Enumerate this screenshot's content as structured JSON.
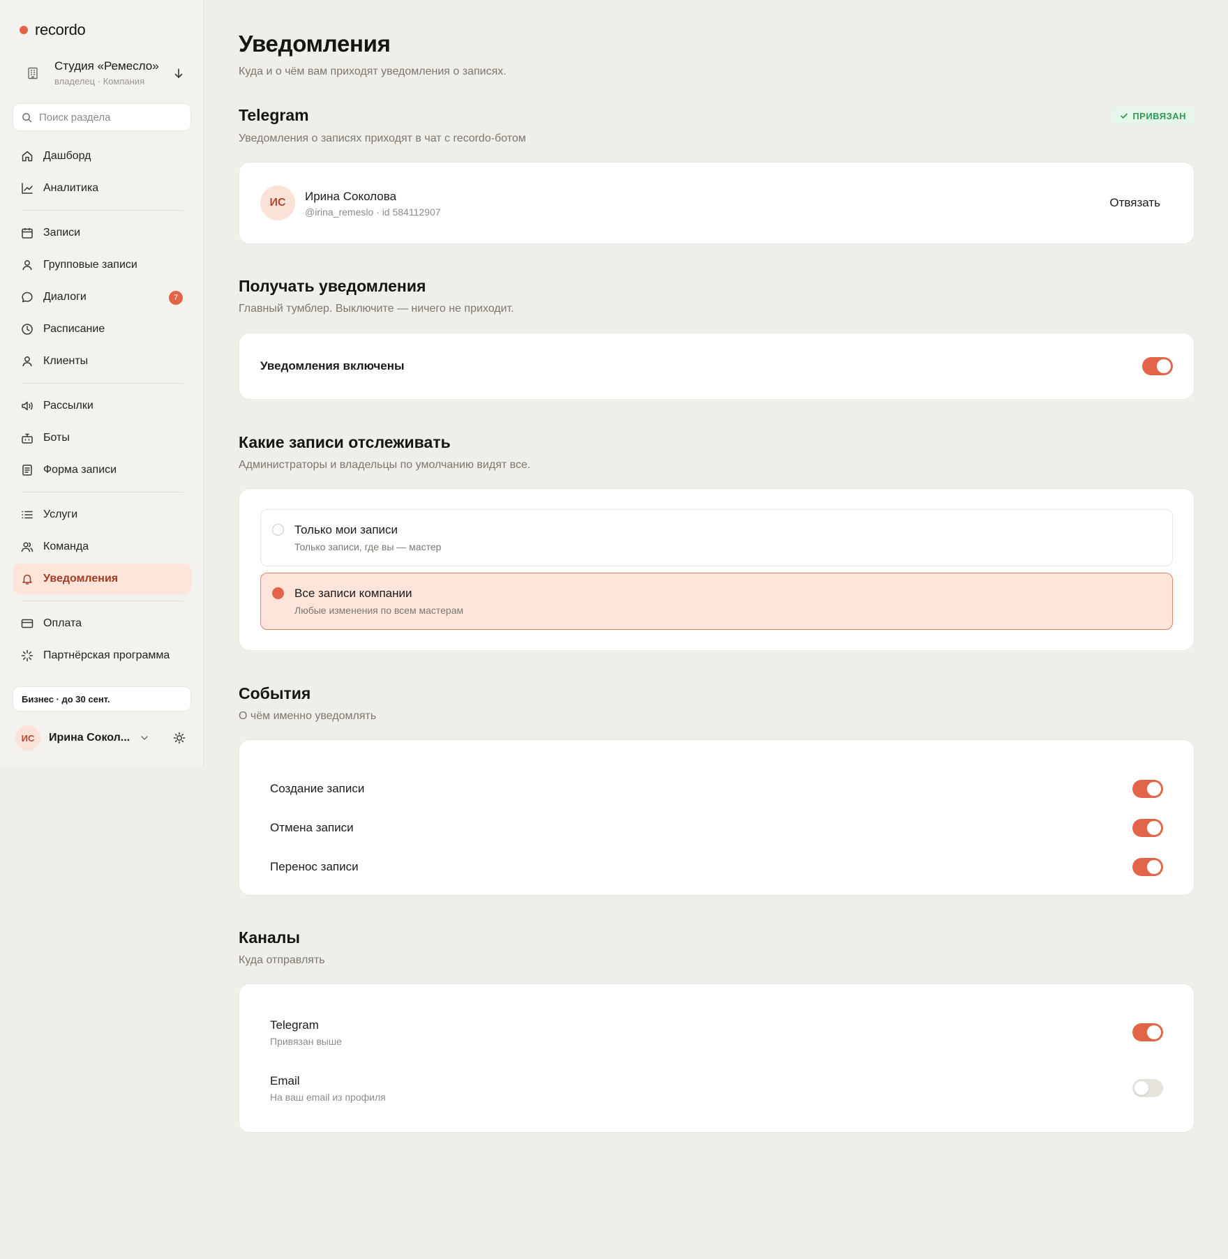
{
  "app": {
    "logo": "recordo",
    "accent": "#e2654a"
  },
  "company": {
    "name": "Студия «Ремесло»",
    "role": "владелец · Компания"
  },
  "search": {
    "placeholder": "Поиск раздела"
  },
  "nav": {
    "group1": [
      {
        "label": "Дашборд",
        "icon": "home-icon"
      },
      {
        "label": "Аналитика",
        "icon": "chart-line-icon"
      }
    ],
    "group2": [
      {
        "label": "Записи",
        "icon": "calendar-icon"
      },
      {
        "label": "Групповые записи",
        "icon": "user-icon"
      },
      {
        "label": "Диалоги",
        "icon": "chat-icon",
        "badge": "7"
      },
      {
        "label": "Расписание",
        "icon": "clock-icon"
      },
      {
        "label": "Клиенты",
        "icon": "user-icon"
      }
    ],
    "group3": [
      {
        "label": "Рассылки",
        "icon": "megaphone-icon"
      },
      {
        "label": "Боты",
        "icon": "bot-icon"
      },
      {
        "label": "Форма записи",
        "icon": "form-icon"
      }
    ],
    "group4": [
      {
        "label": "Услуги",
        "icon": "list-icon"
      },
      {
        "label": "Команда",
        "icon": "users-icon"
      },
      {
        "label": "Уведомления",
        "icon": "bell-icon",
        "active": true
      }
    ],
    "group5": [
      {
        "label": "Оплата",
        "icon": "card-icon"
      },
      {
        "label": "Партнёрская программа",
        "icon": "sparkle-icon"
      }
    ]
  },
  "plan": {
    "label": "Бизнес · до 30 сент."
  },
  "user": {
    "initials": "ИС",
    "name": "Ирина Сокол..."
  },
  "page": {
    "title": "Уведомления",
    "subtitle": "Куда и о чём вам приходят уведомления о записях."
  },
  "telegram": {
    "title": "Telegram",
    "subtitle": "Уведомления о записях приходят в чат с recordo-ботом",
    "status": "ПРИВЯЗАН",
    "account": {
      "initials": "ИС",
      "name": "Ирина Соколова",
      "handle": "@irina_remeslo · id 584112907"
    },
    "unlink_label": "Отвязать"
  },
  "receive": {
    "title": "Получать уведомления",
    "subtitle": "Главный тумблер. Выключите — ничего не приходит.",
    "label": "Уведомления включены",
    "enabled": true
  },
  "scope": {
    "title": "Какие записи отслеживать",
    "subtitle": "Администраторы и владельцы по умолчанию видят все.",
    "options": [
      {
        "title": "Только мои записи",
        "subtitle": "Только записи, где вы — мастер",
        "selected": false
      },
      {
        "title": "Все записи компании",
        "subtitle": "Любые изменения по всем мастерам",
        "selected": true
      }
    ]
  },
  "events": {
    "title": "События",
    "subtitle": "О чём именно уведомлять",
    "items": [
      {
        "label": "Создание записи",
        "enabled": true
      },
      {
        "label": "Отмена записи",
        "enabled": true
      },
      {
        "label": "Перенос записи",
        "enabled": true
      }
    ]
  },
  "channels": {
    "title": "Каналы",
    "subtitle": "Куда отправлять",
    "items": [
      {
        "title": "Telegram",
        "subtitle": "Привязан выше",
        "enabled": true
      },
      {
        "title": "Email",
        "subtitle": "На ваш email из профиля",
        "enabled": false
      }
    ]
  }
}
